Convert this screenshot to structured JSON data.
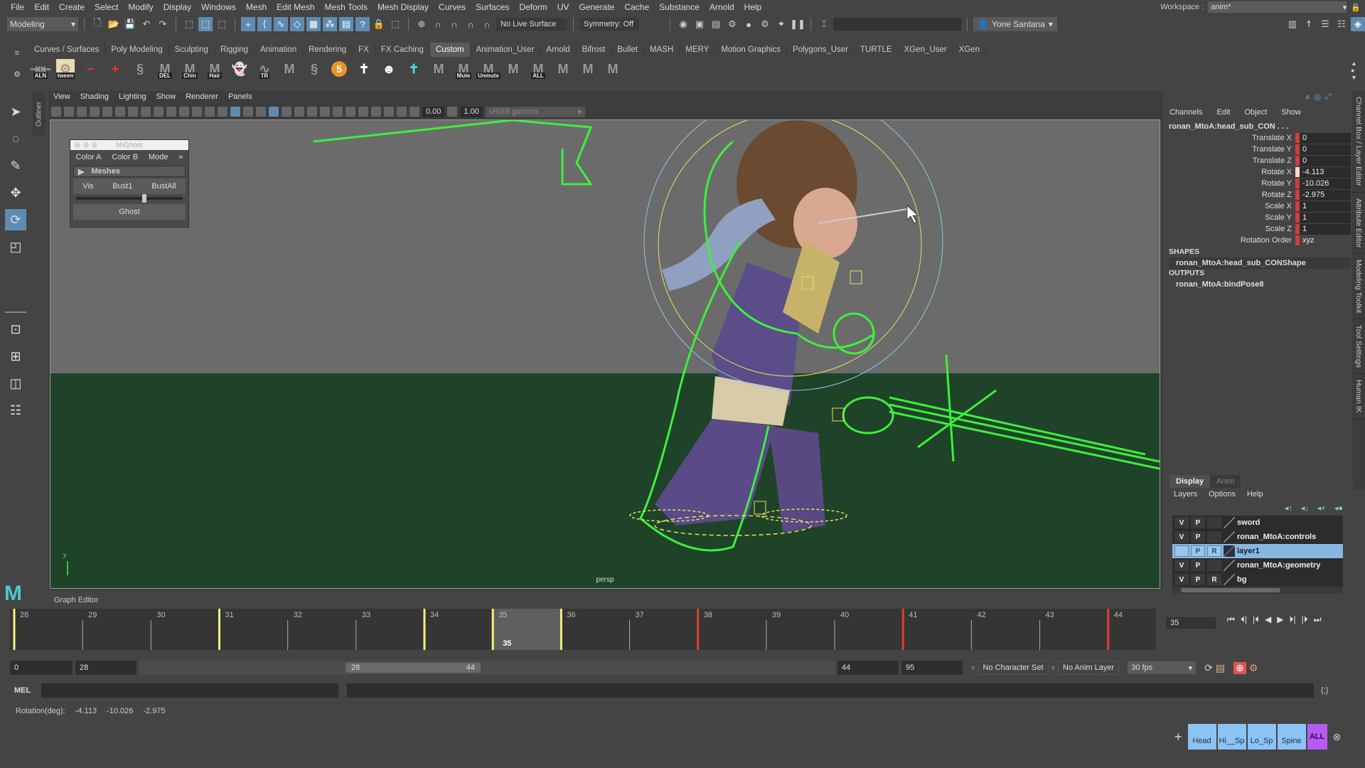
{
  "menubar": {
    "items": [
      "File",
      "Edit",
      "Create",
      "Select",
      "Modify",
      "Display",
      "Windows",
      "Mesh",
      "Edit Mesh",
      "Mesh Tools",
      "Mesh Display",
      "Curves",
      "Surfaces",
      "Deform",
      "UV",
      "Generate",
      "Cache",
      "Substance",
      "Arnold",
      "Help"
    ],
    "workspace_label": "Workspace :",
    "workspace_value": "anim*"
  },
  "statusline": {
    "mode": "Modeling",
    "live_surface": "No Live Surface",
    "symmetry": "Symmetry: Off",
    "user": "Yone Santana"
  },
  "shelf": {
    "tabs": [
      "Curves / Surfaces",
      "Poly Modeling",
      "Sculpting",
      "Rigging",
      "Animation",
      "Rendering",
      "FX",
      "FX Caching",
      "Custom",
      "Animation_User",
      "Arnold",
      "Bifrost",
      "Bullet",
      "MASH",
      "MERY",
      "Motion Graphics",
      "Polygons_User",
      "TURTLE",
      "XGen_User",
      "XGen"
    ],
    "active_tab": "Custom",
    "icons": [
      {
        "name": "align-icon",
        "glyph": "⇥⇤",
        "tag": "ALN"
      },
      {
        "name": "tween-icon",
        "glyph": "⚙",
        "tag": "tween"
      },
      {
        "name": "minus-icon",
        "glyph": "−",
        "tag": ""
      },
      {
        "name": "plus-icon",
        "glyph": "+",
        "tag": ""
      },
      {
        "name": "python-icon",
        "glyph": "§",
        "tag": ""
      },
      {
        "name": "mel-del-icon",
        "glyph": "M",
        "tag": "DEL"
      },
      {
        "name": "mel-chin-icon",
        "glyph": "M",
        "tag": "Chin"
      },
      {
        "name": "mel-hair-icon",
        "glyph": "M",
        "tag": "Hair"
      },
      {
        "name": "ghost-icon",
        "glyph": "👻",
        "tag": ""
      },
      {
        "name": "tr-icon",
        "glyph": "∿",
        "tag": "TR"
      },
      {
        "name": "mel-icon",
        "glyph": "M",
        "tag": ""
      },
      {
        "name": "python-icon-2",
        "glyph": "§",
        "tag": ""
      },
      {
        "name": "five-icon",
        "glyph": "5",
        "tag": ""
      },
      {
        "name": "tpose-icon",
        "glyph": "✝",
        "tag": ""
      },
      {
        "name": "face-icon",
        "glyph": "☻",
        "tag": ""
      },
      {
        "name": "tpose-cyan-icon",
        "glyph": "✝",
        "tag": ""
      },
      {
        "name": "mel-icon-2",
        "glyph": "M",
        "tag": ""
      },
      {
        "name": "mel-mute-icon",
        "glyph": "M",
        "tag": "Mute"
      },
      {
        "name": "mel-unmute-icon",
        "glyph": "M",
        "tag": "Unmute"
      },
      {
        "name": "mel-icon-3",
        "glyph": "M",
        "tag": ""
      },
      {
        "name": "mel-all-icon",
        "glyph": "M",
        "tag": "ALL"
      },
      {
        "name": "mel-icon-4",
        "glyph": "M",
        "tag": ""
      },
      {
        "name": "mel-icon-5",
        "glyph": "M",
        "tag": ""
      },
      {
        "name": "mel-icon-6",
        "glyph": "M",
        "tag": ""
      }
    ]
  },
  "outliner_tab": "Outliner",
  "viewport": {
    "menu": [
      "View",
      "Shading",
      "Lighting",
      "Show",
      "Renderer",
      "Panels"
    ],
    "exposure": "0.00",
    "gamma": "1.00",
    "color_space": "sRGB gamma",
    "camera": "persp",
    "axis_label": "y"
  },
  "bhghost": {
    "title": "bhGhost",
    "menu": [
      "Color A",
      "Color B",
      "Mode"
    ],
    "overflow": "»",
    "section": "Meshes",
    "buttons": [
      "Vis",
      "Bust1",
      "BustAll"
    ],
    "slider_value": 0.62,
    "ghost_button": "Ghost"
  },
  "channel_box": {
    "menu": [
      "Channels",
      "Edit",
      "Object",
      "Show"
    ],
    "object": "ronan_MtoA:head_sub_CON . . .",
    "attributes": [
      {
        "name": "Translate X",
        "value": "0"
      },
      {
        "name": "Translate Y",
        "value": "0"
      },
      {
        "name": "Translate Z",
        "value": "0"
      },
      {
        "name": "Rotate X",
        "value": "-4.113"
      },
      {
        "name": "Rotate Y",
        "value": "-10.026"
      },
      {
        "name": "Rotate Z",
        "value": "-2.975"
      },
      {
        "name": "Scale X",
        "value": "1"
      },
      {
        "name": "Scale Y",
        "value": "1"
      },
      {
        "name": "Scale Z",
        "value": "1"
      },
      {
        "name": "Rotation Order",
        "value": "xyz"
      }
    ],
    "shapes_header": "SHAPES",
    "shape": "ronan_MtoA:head_sub_CONShape",
    "outputs_header": "OUTPUTS",
    "output": "ronan_MtoA:bindPose8"
  },
  "side_tabs": [
    "Channel Box / Layer Editor",
    "Attribute Editor",
    "Modeling Toolkit",
    "Tool Settings",
    "Human IK"
  ],
  "layer_editor": {
    "tabs": [
      "Display",
      "Anim"
    ],
    "menu": [
      "Layers",
      "Options",
      "Help"
    ],
    "layers": [
      {
        "v": "V",
        "p": "P",
        "r": "",
        "name": "sword",
        "selected": false
      },
      {
        "v": "V",
        "p": "P",
        "r": "",
        "name": "ronan_MtoA:controls",
        "selected": false
      },
      {
        "v": "",
        "p": "P",
        "r": "R",
        "name": "layer1",
        "selected": true
      },
      {
        "v": "V",
        "p": "P",
        "r": "",
        "name": "ronan_MtoA:geometry",
        "selected": false
      },
      {
        "v": "V",
        "p": "P",
        "r": "R",
        "name": "bg",
        "selected": false
      }
    ]
  },
  "timeline": {
    "panel_label": "Graph Editor",
    "start": 28,
    "end": 44,
    "current": 35,
    "ticks": [
      28,
      29,
      30,
      31,
      32,
      33,
      34,
      35,
      36,
      37,
      38,
      39,
      40,
      41,
      42,
      43,
      44
    ],
    "keys_yellow": [
      28,
      31,
      34,
      35,
      36
    ],
    "keys_red": [
      38,
      41,
      44
    ],
    "current_frame_field": "35"
  },
  "range": {
    "anim_start": "0",
    "play_start": "28",
    "range_min": "28",
    "range_max": "44",
    "play_end": "44",
    "anim_end": "95",
    "character_set": "No Character Set",
    "anim_layer": "No Anim Layer",
    "fps": "30 fps"
  },
  "mel": {
    "label": "MEL"
  },
  "helpline": {
    "label": "Rotation(deg):",
    "values": [
      "-4.113",
      "-10.026",
      "-2.975"
    ]
  },
  "selector_buttons": [
    "Head",
    "Hi__Sp",
    "Lo_Sp",
    "Spine",
    "ALL"
  ],
  "colors": {
    "accent": "#5f8bb0",
    "key_yellow": "#f5f07a",
    "key_red": "#e03c30",
    "wire_green": "#3cf03c",
    "selected_layer": "#87b7e0"
  }
}
